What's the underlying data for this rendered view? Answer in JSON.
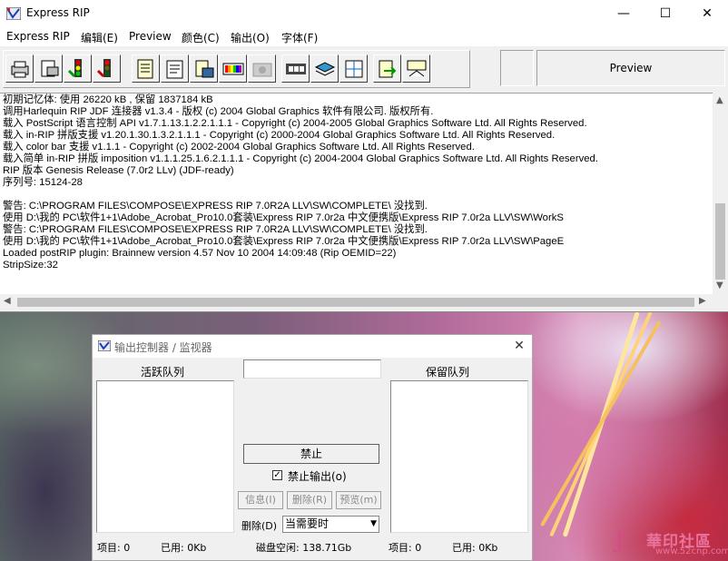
{
  "window": {
    "title": "Express RIP",
    "controls": {
      "minimize": "—",
      "maximize": "☐",
      "close": "✕"
    }
  },
  "menu": [
    "Express RIP",
    "编辑(E)",
    "Preview",
    "颜色(C)",
    "输出(O)",
    "字体(F)"
  ],
  "toolbar": {
    "buttons": [
      "printer-icon",
      "page-setup-icon",
      "go-icon",
      "stop-icon",
      "document-icon",
      "notes-icon",
      "print-doc-icon",
      "color-bars-icon",
      "camera-icon",
      "film-icon",
      "stack-icon",
      "grid-icon",
      "export-icon",
      "output-icon"
    ],
    "preview_label": "Preview"
  },
  "log": [
    "初期记忆体: 使用 26220 kB , 保留 1837184 kB",
    "调用Harlequin RIP JDF 连接器 v1.3.4 - 版权 (c) 2004 Global Graphics 软件有限公司. 版权所有.",
    "载入 PostScript 语言控制 API v1.7.1.13.1.2.2.1.1.1 - Copyright (c) 2004-2005 Global Graphics Software Ltd. All Rights Reserved.",
    "载入 in-RIP 拼版支援 v1.20.1.30.1.3.2.1.1.1 - Copyright (c) 2000-2004 Global Graphics Software Ltd. All Rights Reserved.",
    "载入 color bar 支援  v1.1.1 - Copyright (c) 2002-2004 Global Graphics Software Ltd. All Rights Reserved.",
    "载入简单 in-RIP 拼版 imposition v1.1.1.25.1.6.2.1.1.1 - Copyright (c) 2004-2004 Global Graphics Software Ltd. All Rights Reserved.",
    "RIP 版本 Genesis Release (7.0r2 LLv) (JDF-ready)",
    "序列号: 15124-28",
    "",
    "警告: C:\\PROGRAM FILES\\COMPOSE\\EXPRESS RIP 7.0R2A LLV\\SW\\COMPLETE\\ 没找到.",
    "   使用 D:\\我的 PC\\软件1+1\\Adobe_Acrobat_Pro10.0套装\\Express RIP 7.0r2a 中文便携版\\Express RIP 7.0r2a LLV\\SW\\WorkS",
    "警告: C:\\PROGRAM FILES\\COMPOSE\\EXPRESS RIP 7.0R2A LLV\\SW\\COMPLETE\\ 没找到.",
    "   使用 D:\\我的 PC\\软件1+1\\Adobe_Acrobat_Pro10.0套装\\Express RIP 7.0r2a 中文便携版\\Express RIP 7.0r2a LLV\\SW\\PageE",
    "Loaded postRIP plugin: Brainnew version 4.57 Nov 10 2004 14:09:48 (Rip OEMID=22)",
    "StripSize:32"
  ],
  "dialog": {
    "title": "输出控制器 / 监视器",
    "active_queue": "活跃队列",
    "hold_queue": "保留队列",
    "input_value": "",
    "disable_button": "禁止",
    "disable_output_label": "禁止输出(o)",
    "disable_output_checked": "✓",
    "info_button": "信息(I)",
    "delete_button": "删除(R)",
    "preview_button": "预览(m)",
    "delete_label": "删除(D)",
    "delete_option": "当需要时",
    "left_items": "项目: 0",
    "left_used": "已用: 0Kb",
    "disk_free": "磁盘空闲: 138.71Gb",
    "right_items": "项目: 0",
    "right_used": "已用: 0Kb"
  },
  "watermark": {
    "logo": "ƒ",
    "main": "華印社區",
    "sub": "www.52cnp.com"
  }
}
